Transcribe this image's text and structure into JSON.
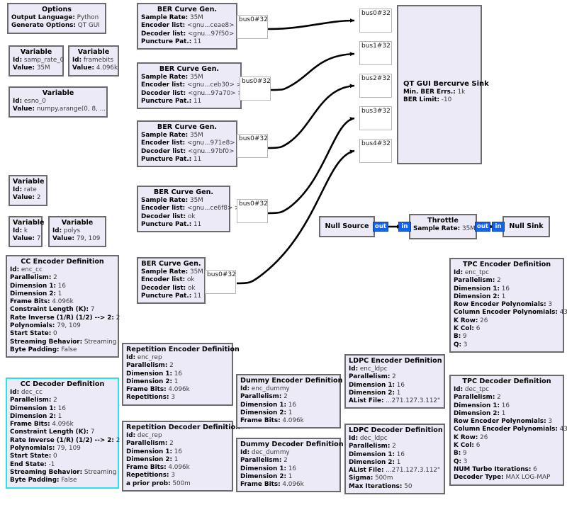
{
  "app": {
    "title": "GNU Radio Companion flowgraph",
    "canvas_bg": "#ffffff",
    "block_fill": "#eceaf7",
    "block_border": "#6b6b6b",
    "selected_border": "#27e0f5",
    "port_blue": "#1763e8"
  },
  "blocks": {
    "options": {
      "title": "Options",
      "rows": [
        {
          "key": "Output Language:",
          "val": "Python"
        },
        {
          "key": "Generate Options:",
          "val": "QT GUI"
        }
      ]
    },
    "var_samp_rate_0": {
      "title": "Variable",
      "rows": [
        {
          "key": "Id:",
          "val": "samp_rate_0"
        },
        {
          "key": "Value:",
          "val": "35M"
        }
      ]
    },
    "var_framebits": {
      "title": "Variable",
      "rows": [
        {
          "key": "Id:",
          "val": "framebits"
        },
        {
          "key": "Value:",
          "val": "4.096k"
        }
      ]
    },
    "var_esno_0": {
      "title": "Variable",
      "rows": [
        {
          "key": "Id:",
          "val": "esno_0"
        },
        {
          "key": "Value:",
          "val": "numpy.arange(0, 8, ..."
        }
      ]
    },
    "var_rate": {
      "title": "Variable",
      "rows": [
        {
          "key": "Id:",
          "val": "rate"
        },
        {
          "key": "Value:",
          "val": "2"
        }
      ]
    },
    "var_k": {
      "title": "Variable",
      "rows": [
        {
          "key": "Id:",
          "val": "k"
        },
        {
          "key": "Value:",
          "val": "7"
        }
      ]
    },
    "var_polys": {
      "title": "Variable",
      "rows": [
        {
          "key": "Id:",
          "val": "polys"
        },
        {
          "key": "Value:",
          "val": "79, 109"
        }
      ]
    },
    "ber1": {
      "title": "BER Curve Gen.",
      "rows": [
        {
          "key": "Sample Rate:",
          "val": "35M"
        },
        {
          "key": "Encoder list:",
          "val": "<gnu...ceae8> >"
        },
        {
          "key": "Decoder list:",
          "val": "<gnu...97f50> >"
        },
        {
          "key": "Puncture Pat.:",
          "val": "11"
        }
      ],
      "port": "bus0#32"
    },
    "ber2": {
      "title": "BER Curve Gen.",
      "rows": [
        {
          "key": "Sample Rate:",
          "val": "35M"
        },
        {
          "key": "Encoder list:",
          "val": "<gnu...ceb30> >"
        },
        {
          "key": "Decoder list:",
          "val": "<gnu...97a70> >"
        },
        {
          "key": "Puncture Pat.:",
          "val": "11"
        }
      ],
      "port": "bus0#32"
    },
    "ber3": {
      "title": "BER Curve Gen.",
      "rows": [
        {
          "key": "Sample Rate:",
          "val": "35M"
        },
        {
          "key": "Encoder list:",
          "val": "<gnu...971e8> >"
        },
        {
          "key": "Decoder list:",
          "val": "<gnu...97bf0> >"
        },
        {
          "key": "Puncture Pat.:",
          "val": "11"
        }
      ],
      "port": "bus0#32"
    },
    "ber4": {
      "title": "BER Curve Gen.",
      "rows": [
        {
          "key": "Sample Rate:",
          "val": "35M"
        },
        {
          "key": "Encoder list:",
          "val": "<gnu...ce6f8> >"
        },
        {
          "key": "Decoder list:",
          "val": "ok"
        },
        {
          "key": "Puncture Pat.:",
          "val": "11"
        }
      ],
      "port": "bus0#32"
    },
    "ber5": {
      "title": "BER Curve Gen.",
      "rows": [
        {
          "key": "Sample Rate:",
          "val": "35M"
        },
        {
          "key": "Encoder list:",
          "val": "ok"
        },
        {
          "key": "Decoder list:",
          "val": "ok"
        },
        {
          "key": "Puncture Pat.:",
          "val": "11"
        }
      ],
      "port": "bus0#32"
    },
    "bercurve_sink": {
      "title": "QT GUI Bercurve Sink",
      "rows": [
        {
          "key": "Min. BER Errs.:",
          "val": "1k"
        },
        {
          "key": "BER Limit:",
          "val": "-10"
        }
      ],
      "in_ports": [
        "bus0#32",
        "bus1#32",
        "bus2#32",
        "bus3#32",
        "bus4#32"
      ]
    },
    "null_source": {
      "title": "Null Source",
      "rows": [],
      "out_port": "out"
    },
    "throttle": {
      "title": "Throttle",
      "rows": [
        {
          "key": "Sample Rate:",
          "val": "35M"
        }
      ],
      "in_port": "in",
      "out_port": "out"
    },
    "null_sink": {
      "title": "Null Sink",
      "rows": [],
      "in_port": "in"
    },
    "cc_encoder": {
      "title": "CC Encoder Definition",
      "selected": false,
      "rows": [
        {
          "key": "Id:",
          "val": "enc_cc"
        },
        {
          "key": "Parallelism:",
          "val": "2"
        },
        {
          "key": "Dimension 1:",
          "val": "16"
        },
        {
          "key": "Dimension 2:",
          "val": "1"
        },
        {
          "key": "Frame Bits:",
          "val": "4.096k"
        },
        {
          "key": "Constraint Length (K):",
          "val": "7"
        },
        {
          "key": "Rate Inverse (1/R) (1/2) --> 2:",
          "val": "2"
        },
        {
          "key": "Polynomials:",
          "val": "79, 109"
        },
        {
          "key": "Start State:",
          "val": "0"
        },
        {
          "key": "Streaming Behavior:",
          "val": "Streaming"
        },
        {
          "key": "Byte Padding:",
          "val": "False"
        }
      ]
    },
    "cc_decoder": {
      "title": "CC Decoder Definition",
      "selected": true,
      "rows": [
        {
          "key": "Id:",
          "val": "dec_cc"
        },
        {
          "key": "Parallelism:",
          "val": "2"
        },
        {
          "key": "Dimension 1:",
          "val": "16"
        },
        {
          "key": "Dimension 2:",
          "val": "1"
        },
        {
          "key": "Frame Bits:",
          "val": "4.096k"
        },
        {
          "key": "Constraint Length (K):",
          "val": "7"
        },
        {
          "key": "Rate Inverse (1/R) (1/2) --> 2:",
          "val": "2"
        },
        {
          "key": "Polynomials:",
          "val": "79, 109"
        },
        {
          "key": "Start State:",
          "val": "0"
        },
        {
          "key": "End State:",
          "val": "-1"
        },
        {
          "key": "Streaming Behavior:",
          "val": "Streaming"
        },
        {
          "key": "Byte Padding:",
          "val": "False"
        }
      ]
    },
    "rep_encoder": {
      "title": "Repetition Encoder Definition",
      "rows": [
        {
          "key": "Id:",
          "val": "enc_rep"
        },
        {
          "key": "Parallelism:",
          "val": "2"
        },
        {
          "key": "Dimension 1:",
          "val": "16"
        },
        {
          "key": "Dimension 2:",
          "val": "1"
        },
        {
          "key": "Frame Bits:",
          "val": "4.096k"
        },
        {
          "key": "Repetitions:",
          "val": "3"
        }
      ]
    },
    "rep_decoder": {
      "title": "Repetition Decoder Definition",
      "rows": [
        {
          "key": "Id:",
          "val": "dec_rep"
        },
        {
          "key": "Parallelism:",
          "val": "2"
        },
        {
          "key": "Dimension 1:",
          "val": "16"
        },
        {
          "key": "Dimension 2:",
          "val": "1"
        },
        {
          "key": "Frame Bits:",
          "val": "4.096k"
        },
        {
          "key": "Repetitions:",
          "val": "3"
        },
        {
          "key": "a prior prob:",
          "val": "500m"
        }
      ]
    },
    "dummy_encoder": {
      "title": "Dummy Encoder Definition",
      "rows": [
        {
          "key": "Id:",
          "val": "enc_dummy"
        },
        {
          "key": "Parallelism:",
          "val": "2"
        },
        {
          "key": "Dimension 1:",
          "val": "16"
        },
        {
          "key": "Dimension 2:",
          "val": "1"
        },
        {
          "key": "Frame Bits:",
          "val": "4.096k"
        }
      ]
    },
    "dummy_decoder": {
      "title": "Dummy Decoder Definition",
      "rows": [
        {
          "key": "Id:",
          "val": "dec_dummy"
        },
        {
          "key": "Parallelism:",
          "val": "2"
        },
        {
          "key": "Dimension 1:",
          "val": "16"
        },
        {
          "key": "Dimension 2:",
          "val": "1"
        },
        {
          "key": "Frame Bits:",
          "val": "4.096k"
        }
      ]
    },
    "ldpc_encoder": {
      "title": "LDPC Encoder Definition",
      "rows": [
        {
          "key": "Id:",
          "val": "enc_ldpc"
        },
        {
          "key": "Parallelism:",
          "val": "2"
        },
        {
          "key": "Dimension 1:",
          "val": "16"
        },
        {
          "key": "Dimension 2:",
          "val": "1"
        },
        {
          "key": "AList File:",
          "val": "...271.127.3.112\""
        }
      ]
    },
    "ldpc_decoder": {
      "title": "LDPC Decoder Definition",
      "rows": [
        {
          "key": "Id:",
          "val": "dec_ldpc"
        },
        {
          "key": "Parallelism:",
          "val": "2"
        },
        {
          "key": "Dimension 1:",
          "val": "16"
        },
        {
          "key": "Dimension 2:",
          "val": "1"
        },
        {
          "key": "AList File:",
          "val": "...271.127.3.112\""
        },
        {
          "key": "Sigma:",
          "val": "500m"
        },
        {
          "key": "Max Iterations:",
          "val": "50"
        }
      ]
    },
    "tpc_encoder": {
      "title": "TPC Encoder Definition",
      "rows": [
        {
          "key": "Id:",
          "val": "enc_tpc"
        },
        {
          "key": "Parallelism:",
          "val": "2"
        },
        {
          "key": "Dimension 1:",
          "val": "16"
        },
        {
          "key": "Dimension 2:",
          "val": "1"
        },
        {
          "key": "Row Encoder Polynomials:",
          "val": "3"
        },
        {
          "key": "Column Encoder Polynomials:",
          "val": "43"
        },
        {
          "key": "K Row:",
          "val": "26"
        },
        {
          "key": "K Col:",
          "val": "6"
        },
        {
          "key": "B:",
          "val": "9"
        },
        {
          "key": "Q:",
          "val": "3"
        }
      ]
    },
    "tpc_decoder": {
      "title": "TPC Decoder Definition",
      "rows": [
        {
          "key": "Id:",
          "val": "dec_tpc"
        },
        {
          "key": "Parallelism:",
          "val": "2"
        },
        {
          "key": "Dimension 1:",
          "val": "16"
        },
        {
          "key": "Dimension 2:",
          "val": "1"
        },
        {
          "key": "Row Encoder Polynomials:",
          "val": "3"
        },
        {
          "key": "Column Encoder Polynomials:",
          "val": "43"
        },
        {
          "key": "K Row:",
          "val": "26"
        },
        {
          "key": "K Col:",
          "val": "6"
        },
        {
          "key": "B:",
          "val": "9"
        },
        {
          "key": "Q:",
          "val": "3"
        },
        {
          "key": "NUM Turbo Iterations:",
          "val": "6"
        },
        {
          "key": "Decoder Type:",
          "val": "MAX LOG-MAP"
        }
      ]
    }
  }
}
